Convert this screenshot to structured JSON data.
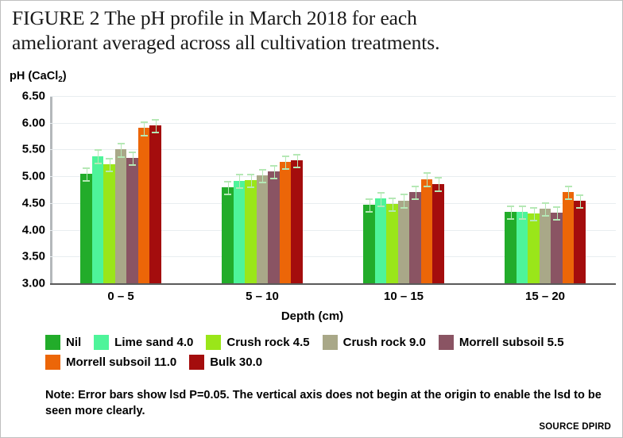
{
  "figure": {
    "title": "FIGURE 2  The pH profile in March 2018 for each\nameliorant averaged across all cultivation treatments.",
    "note": "Note: Error bars show lsd P=0.05. The vertical axis does not begin at the origin to enable the lsd to be seen more clearly.",
    "source": "SOURCE DPIRD"
  },
  "chart_data": {
    "type": "bar",
    "title": "The pH profile in March 2018 for each ameliorant averaged across all cultivation treatments.",
    "xlabel": "Depth (cm)",
    "ylabel": "pH (CaCl2)",
    "ylabel_html": "pH (CaCl<sub>2</sub>)",
    "categories": [
      "0 – 5",
      "5 – 10",
      "10 – 15",
      "15 – 20"
    ],
    "ylim": [
      3.0,
      6.5
    ],
    "yticks": [
      "3.00",
      "3.50",
      "4.00",
      "4.50",
      "5.00",
      "5.50",
      "6.00",
      "6.50"
    ],
    "ytick_values": [
      3.0,
      3.5,
      4.0,
      4.5,
      5.0,
      5.5,
      6.0,
      6.5
    ],
    "grid": true,
    "legend_position": "bottom",
    "error_bars": "lsd P=0.05",
    "error_value": 0.12,
    "series": [
      {
        "name": "Nil",
        "color": "#22ac2a",
        "values": [
          5.05,
          4.79,
          4.47,
          4.33
        ]
      },
      {
        "name": "Lime sand 4.0",
        "color": "#4ef49a",
        "values": [
          5.38,
          4.92,
          4.58,
          4.33
        ]
      },
      {
        "name": "Crush rock 4.5",
        "color": "#9ae619",
        "values": [
          5.23,
          4.93,
          4.48,
          4.3
        ]
      },
      {
        "name": "Crush rock 9.0",
        "color": "#a9a888",
        "values": [
          5.5,
          5.02,
          4.55,
          4.39
        ]
      },
      {
        "name": "Morrell subsoil 5.5",
        "color": "#8a5463",
        "values": [
          5.34,
          5.09,
          4.7,
          4.32
        ]
      },
      {
        "name": "Morrell subsoil 11.0",
        "color": "#ec6608",
        "values": [
          5.9,
          5.27,
          4.95,
          4.71
        ]
      },
      {
        "name": "Bulk 30.0",
        "color": "#a40d0d",
        "values": [
          5.95,
          5.3,
          4.86,
          4.54
        ]
      }
    ]
  }
}
